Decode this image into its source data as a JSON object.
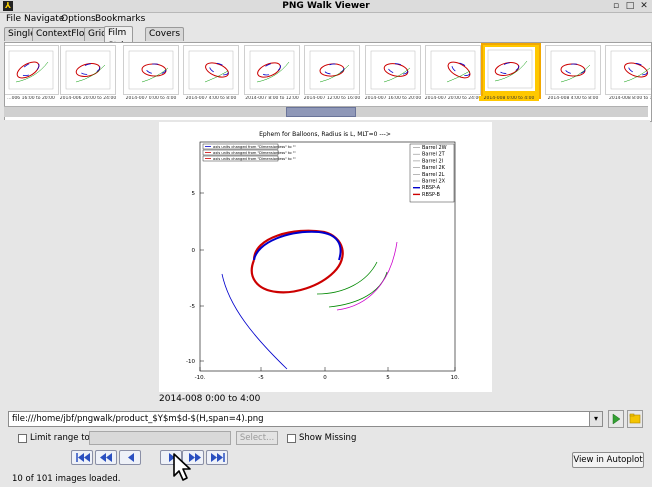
{
  "window": {
    "title": "PNG Walk Viewer"
  },
  "menu": [
    "File",
    "Navigate",
    "Options",
    "Bookmarks"
  ],
  "tabs": [
    "Single",
    "ContextFlow",
    "Grid",
    "Film Strip",
    "Covers"
  ],
  "active_tab": "Film Strip",
  "film_strip": {
    "captions": [
      "…006 16:00 to 20:00",
      "2014-006 20:00 to 24:00",
      "2014-007 0:00 to 4:00",
      "2014-007 4:00 to 8:00",
      "2014-007 8:00 to 12:00",
      "2014-007 12:00 to 16:00",
      "2014-007 16:00 to 20:00",
      "2014-007 20:00 to 24:00",
      "2014-008 0:00 to 4:00",
      "2014-008 4:00 to 8:00",
      "2014-008 8:00 to 1…"
    ],
    "selected_index": 8
  },
  "plot": {
    "title": "Ephem for Balloons, Radius is L, MLT=0 --->",
    "legend": [
      "Barrel 2W",
      "Barrel 2T",
      "Barrel 2I",
      "Barrel 2K",
      "Barrel 2L",
      "Barrel 2X",
      "RBSP-A",
      "RBSP-B"
    ],
    "legend_colors": [
      "#888888",
      "#888888",
      "#888888",
      "#888888",
      "#888888",
      "#888888",
      "#0000cc",
      "#cc0000"
    ],
    "notes": [
      "axis units changed from \"Dimensionless\" to \"\"",
      "axis units changed from \"Dimensionless\" to \"\"",
      "axis units changed from \"Dimensionless\" to \"\""
    ],
    "x_ticks": [
      "-10.",
      "-5",
      "0",
      "5",
      "10."
    ],
    "y_ticks": [
      "5",
      "0",
      "-5",
      "-10"
    ],
    "caption": "2014-008 0:00 to 4:00"
  },
  "url": {
    "value": "file:///home/jbf/pngwalk/product_$Y$m$d-$(H,span=4).png"
  },
  "options": {
    "limit_range_label": "Limit range to:",
    "select_label": "Select...",
    "show_missing_label": "Show Missing"
  },
  "autoplot_label": "View in Autoplot",
  "status": "10 of 101 images loaded."
}
